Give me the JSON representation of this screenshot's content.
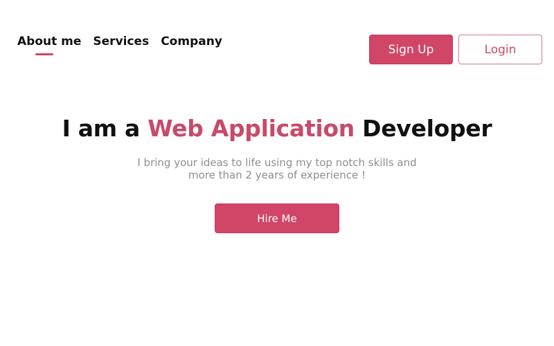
{
  "nav": {
    "items": [
      {
        "label": "About me",
        "active": true
      },
      {
        "label": "Services",
        "active": false
      },
      {
        "label": "Company",
        "active": false
      }
    ]
  },
  "auth": {
    "signup_label": "Sign Up",
    "login_label": "Login"
  },
  "hero": {
    "title_prefix": "I am a ",
    "title_accent": "Web Application",
    "title_suffix": " Developer",
    "subtitle": "I bring your ideas to life using my top notch skills and more than 2 years of experience !",
    "cta_label": "Hire Me"
  },
  "colors": {
    "accent": "#d14566",
    "text": "#111111",
    "muted": "#8e8e8e",
    "background": "#ffffff"
  }
}
